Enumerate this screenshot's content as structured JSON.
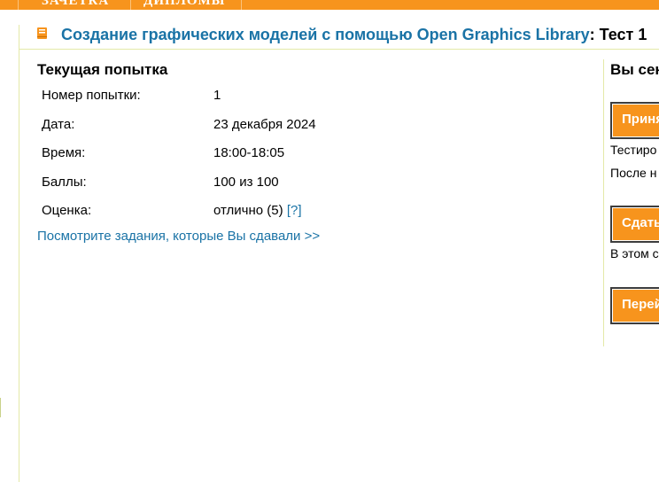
{
  "topnav": {
    "items": [
      "ЗАЧЕТКА",
      "ДИПЛОМЫ"
    ]
  },
  "header": {
    "course_title": "Создание графических моделей с помощью Open Graphics Library",
    "test_name": ": Тест 1"
  },
  "attempt": {
    "heading": "Текущая попытка",
    "rows": [
      {
        "label": "Номер попытки:",
        "value": "1"
      },
      {
        "label": "Дата:",
        "value": "23 декабря 2024"
      },
      {
        "label": "Время:",
        "value": "18:00-18:05"
      },
      {
        "label": "Баллы:",
        "value": "100 из 100"
      },
      {
        "label": "Оценка:",
        "value": "отлично (5)"
      }
    ],
    "help_link": "[?]",
    "submissions_link": "Посмотрите задания, которые Вы сдавали >>"
  },
  "sidebar": {
    "heading": "Вы сен",
    "buttons": [
      "Приня",
      "Сдать",
      "Перей"
    ],
    "texts": [
      "Тестиро",
      "После н",
      "В этом с"
    ]
  },
  "colors": {
    "accent": "#f7941d",
    "link": "#1a73a6",
    "divider": "#e4e9a8"
  }
}
